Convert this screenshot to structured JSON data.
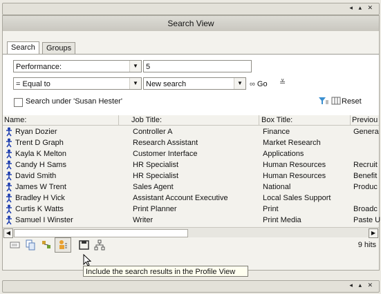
{
  "panel": {
    "title": "Search View"
  },
  "tabs": [
    {
      "label": "Search"
    },
    {
      "label": "Groups"
    }
  ],
  "form": {
    "field_select": "Performance:",
    "value_input": "5",
    "operator_select": "= Equal to",
    "mode_select": "New search",
    "go_label": "Go",
    "search_under_label": "Search under 'Susan Hester'",
    "reset_label": "Reset"
  },
  "table": {
    "headers": [
      "Name:",
      "Job Title:",
      "Box Title:",
      "Previou"
    ],
    "rows": [
      [
        "Ryan  Dozier",
        "Controller A",
        "Finance",
        "Genera"
      ],
      [
        "Trent D Graph",
        "Research Assistant",
        "Market Research",
        ""
      ],
      [
        "Kayla K Melton",
        "Customer Interface",
        "Applications",
        ""
      ],
      [
        "Candy H Sams",
        "HR Specialist",
        "Human Resources",
        "Recruit"
      ],
      [
        "David  Smith",
        "HR Specialist",
        "Human Resources",
        "Benefit"
      ],
      [
        "James W Trent",
        "Sales Agent",
        "National",
        "Produc"
      ],
      [
        "Bradley H Vick",
        "Assistant Account Executive",
        "Local Sales Support",
        ""
      ],
      [
        "Curtis K Watts",
        "Print Planner",
        "Print",
        "Broadc"
      ],
      [
        "Samuel I Winster",
        "Writer",
        "Print Media",
        "Paste U"
      ]
    ]
  },
  "status": {
    "hits": "9 hits"
  },
  "tooltip": {
    "text": "Include the search results in the Profile View"
  },
  "colors": {
    "person_icon": "#1f3fb0",
    "titlebar": "#cfcdc6",
    "tooltip_bg": "#fffff0"
  }
}
